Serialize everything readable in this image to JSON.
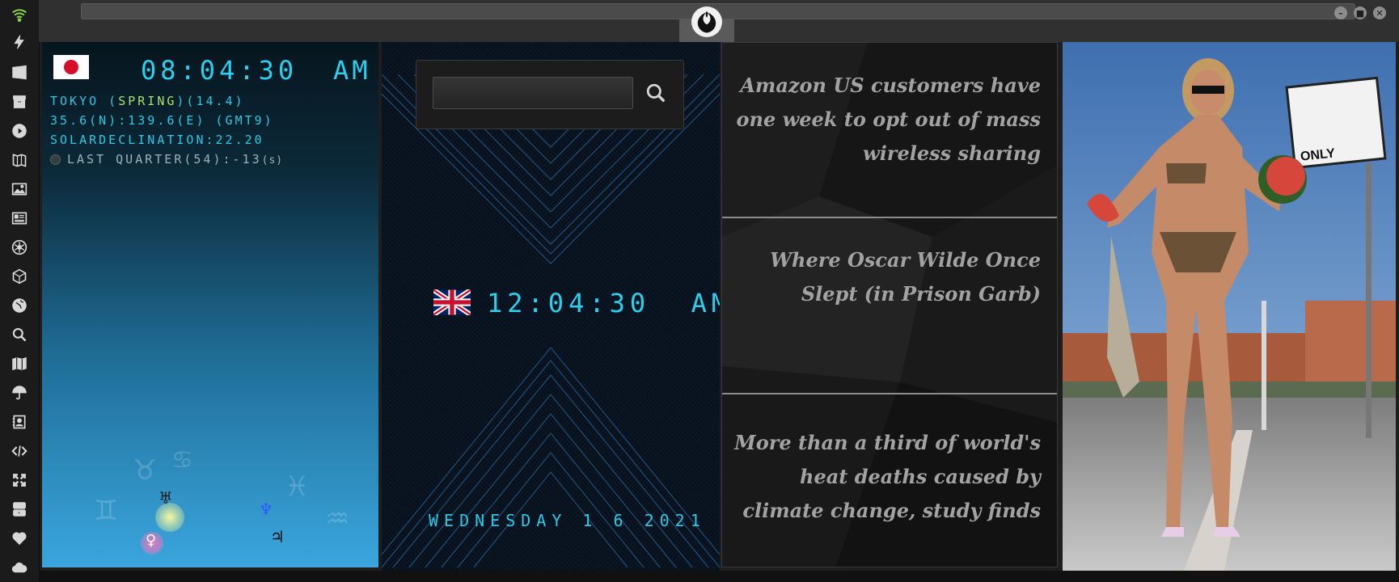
{
  "sidebar": {
    "items": [
      {
        "name": "wifi-icon",
        "glyph": ""
      },
      {
        "name": "lightning-icon",
        "glyph": "⚡"
      },
      {
        "name": "windows-icon",
        "glyph": ""
      },
      {
        "name": "archive-icon",
        "glyph": ""
      },
      {
        "name": "play-icon",
        "glyph": "▶"
      },
      {
        "name": "map-book-icon",
        "glyph": ""
      },
      {
        "name": "image-icon",
        "glyph": ""
      },
      {
        "name": "news-icon",
        "glyph": ""
      },
      {
        "name": "atom-icon",
        "glyph": "✻"
      },
      {
        "name": "hexagon-icon",
        "glyph": "⬡"
      },
      {
        "name": "globe-icon",
        "glyph": "◕"
      },
      {
        "name": "search-icon",
        "glyph": ""
      },
      {
        "name": "map-icon",
        "glyph": ""
      },
      {
        "name": "umbrella-icon",
        "glyph": "☂"
      },
      {
        "name": "contact-icon",
        "glyph": ""
      },
      {
        "name": "code-icon",
        "glyph": "◇"
      },
      {
        "name": "expand-icon",
        "glyph": "✚"
      },
      {
        "name": "youtube-icon",
        "glyph": ""
      },
      {
        "name": "heart-icon",
        "glyph": "♥"
      },
      {
        "name": "cloud-icon",
        "glyph": "☁"
      }
    ]
  },
  "tokyo": {
    "time": "08:04:30",
    "ampm": "AM",
    "location_prefix": "TOKYO (",
    "season": "SPRING",
    "location_suffix": ")(14.4)",
    "coords": "35.6(N):139.6(E) (GMT9)",
    "solar": "SOLARDECLINATION:22.20",
    "moon": "LAST QUARTER(54):-13",
    "moon_unit": "(s)",
    "planets": {
      "uranus": "♅",
      "neptune": "♆",
      "venus": "♀",
      "jupiter": "♃"
    }
  },
  "uk": {
    "time": "12:04:30",
    "ampm": "AM",
    "date": "WEDNESDAY 1 6 2021",
    "search_value": ""
  },
  "news": {
    "items": [
      "Amazon US customers have one week to opt out of mass wireless sharing",
      "Where Oscar Wilde Once Slept (in Prison Garb)",
      "More than a third of world's heat deaths caused by climate change, study finds"
    ]
  },
  "photo": {
    "sign_text": "ONLY"
  },
  "colors": {
    "digital": "#2ad0ee",
    "season_highlight": "#a8e26a",
    "news_text": "#a2a2a2"
  }
}
